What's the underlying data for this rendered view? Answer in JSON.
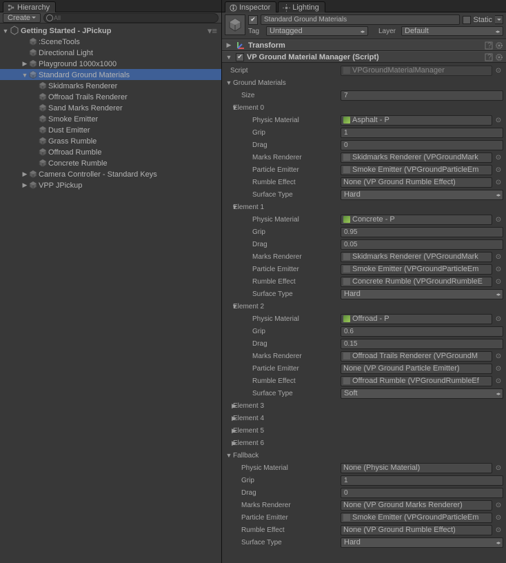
{
  "hierarchy": {
    "tab": "Hierarchy",
    "create": "Create",
    "search_placeholder": "All",
    "root": "Getting Started - JPickup",
    "items": [
      {
        "name": ":SceneTools",
        "depth": 2,
        "fold": ""
      },
      {
        "name": "Directional Light",
        "depth": 2,
        "fold": ""
      },
      {
        "name": "Playground 1000x1000",
        "depth": 2,
        "fold": "▶"
      },
      {
        "name": "Standard Ground Materials",
        "depth": 2,
        "fold": "▼",
        "sel": true
      },
      {
        "name": "Skidmarks Renderer",
        "depth": 3,
        "fold": ""
      },
      {
        "name": "Offroad Trails Renderer",
        "depth": 3,
        "fold": ""
      },
      {
        "name": "Sand Marks Renderer",
        "depth": 3,
        "fold": ""
      },
      {
        "name": "Smoke Emitter",
        "depth": 3,
        "fold": ""
      },
      {
        "name": "Dust Emitter",
        "depth": 3,
        "fold": ""
      },
      {
        "name": "Grass Rumble",
        "depth": 3,
        "fold": ""
      },
      {
        "name": "Offroad Rumble",
        "depth": 3,
        "fold": ""
      },
      {
        "name": "Concrete Rumble",
        "depth": 3,
        "fold": ""
      },
      {
        "name": "Camera Controller - Standard Keys",
        "depth": 2,
        "fold": "▶"
      },
      {
        "name": "VPP JPickup",
        "depth": 2,
        "fold": "▶"
      }
    ]
  },
  "inspector": {
    "tab": "Inspector",
    "tab2": "Lighting",
    "objectName": "Standard Ground Materials",
    "static": "Static",
    "tagLabel": "Tag",
    "tag": "Untagged",
    "layerLabel": "Layer",
    "layer": "Default",
    "transform": "Transform",
    "compTitle": "VP Ground Material Manager (Script)",
    "scriptLabel": "Script",
    "script": "VPGroundMaterialManager",
    "gmLabel": "Ground Materials",
    "sizeLabel": "Size",
    "size": "7",
    "labels": {
      "physic": "Physic Material",
      "grip": "Grip",
      "drag": "Drag",
      "marks": "Marks Renderer",
      "particle": "Particle Emitter",
      "rumble": "Rumble Effect",
      "surface": "Surface Type"
    },
    "elements": [
      {
        "title": "Element 0",
        "open": true,
        "physic": "Asphalt - P",
        "mat": true,
        "grip": "1",
        "drag": "0",
        "marks": "Skidmarks Renderer (VPGroundMark",
        "particle": "Smoke Emitter (VPGroundParticleEm",
        "rumble": "None (VP Ground Rumble Effect)",
        "rumbleIcon": false,
        "surface": "Hard"
      },
      {
        "title": "Element 1",
        "open": true,
        "physic": "Concrete - P",
        "mat": true,
        "grip": "0.95",
        "drag": "0.05",
        "marks": "Skidmarks Renderer (VPGroundMark",
        "particle": "Smoke Emitter (VPGroundParticleEm",
        "rumble": "Concrete Rumble (VPGroundRumbleE",
        "rumbleIcon": true,
        "surface": "Hard"
      },
      {
        "title": "Element 2",
        "open": true,
        "physic": "Offroad - P",
        "mat": true,
        "grip": "0.6",
        "drag": "0.15",
        "marks": "Offroad Trails Renderer (VPGroundM",
        "particle": "None (VP Ground Particle Emitter)",
        "particleIcon": false,
        "rumble": "Offroad Rumble (VPGroundRumbleEf",
        "rumbleIcon": true,
        "surface": "Soft"
      },
      {
        "title": "Element 3",
        "open": false
      },
      {
        "title": "Element 4",
        "open": false
      },
      {
        "title": "Element 5",
        "open": false
      },
      {
        "title": "Element 6",
        "open": false
      }
    ],
    "fallback": {
      "title": "Fallback",
      "physic": "None (Physic Material)",
      "mat": false,
      "grip": "1",
      "drag": "0",
      "marks": "None (VP Ground Marks Renderer)",
      "marksIcon": false,
      "particle": "Smoke Emitter (VPGroundParticleEm",
      "particleIcon": true,
      "rumble": "None (VP Ground Rumble Effect)",
      "rumbleIcon": false,
      "surface": "Hard"
    }
  }
}
